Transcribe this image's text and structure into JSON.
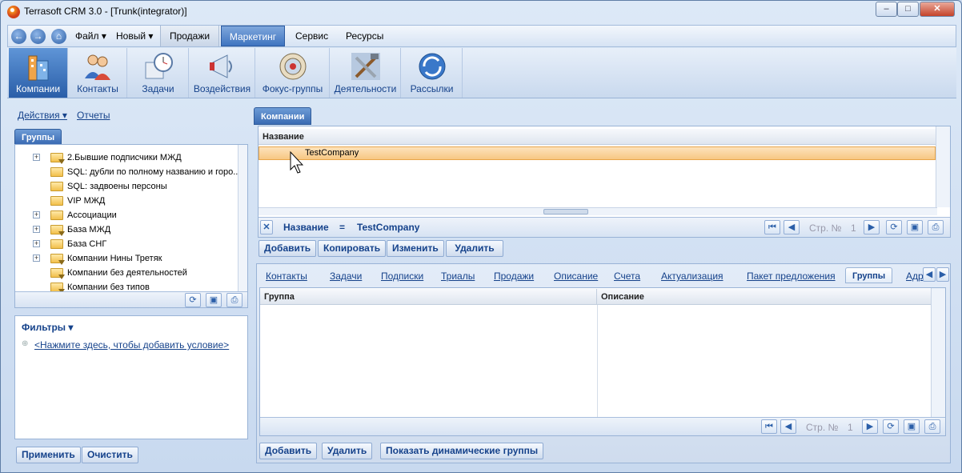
{
  "window": {
    "title": "Terrasoft CRM 3.0 - [Trunk(integrator)]"
  },
  "menubar": {
    "items": [
      "Файл",
      "Новый",
      "Продажи",
      "Маркетинг",
      "Сервис",
      "Ресурсы"
    ]
  },
  "ribbon": {
    "items": [
      "Компании",
      "Контакты",
      "Задачи",
      "Воздействия",
      "Фокус-группы",
      "Деятельности",
      "Рассылки"
    ]
  },
  "left": {
    "actions": "Действия",
    "reports": "Отчеты",
    "groups_tab": "Группы",
    "tree": [
      {
        "label": "2.Бывшие подписчики МЖД",
        "expand": true,
        "filter": true
      },
      {
        "label": "SQL: дубли по полному названию и горо...",
        "expand": false,
        "filter": false
      },
      {
        "label": "SQL: задвоены персоны",
        "expand": false,
        "filter": false
      },
      {
        "label": "VIP МЖД",
        "expand": false,
        "filter": false
      },
      {
        "label": "Ассоциации",
        "expand": true,
        "filter": false
      },
      {
        "label": "База МЖД",
        "expand": true,
        "filter": true
      },
      {
        "label": "База СНГ",
        "expand": true,
        "filter": false
      },
      {
        "label": "Компании Нины Третяк",
        "expand": true,
        "filter": true
      },
      {
        "label": "Компании без деятельностей",
        "expand": false,
        "filter": true
      },
      {
        "label": "Компании без типов",
        "expand": false,
        "filter": true
      }
    ],
    "filters_title": "Фильтры",
    "filters_add": "<Нажмите здесь, чтобы добавить условие>",
    "apply": "Применить",
    "clear": "Очистить"
  },
  "companies": {
    "tab": "Компании",
    "col_name": "Название",
    "row": "TestCompany",
    "filter_field": "Название",
    "filter_op": "=",
    "filter_value": "TestCompany",
    "page_label": "Стр. №",
    "page": "1",
    "buttons": [
      "Добавить",
      "Копировать",
      "Изменить",
      "Удалить"
    ]
  },
  "details": {
    "tabs": [
      "Контакты",
      "Задачи",
      "Подписки",
      "Триалы",
      "Продажи",
      "Описание",
      "Счета",
      "Актуализация",
      "Пакет предложения",
      "Группы",
      "Адр"
    ],
    "active_tab": "Группы",
    "col_group": "Группа",
    "col_desc": "Описание",
    "page_label": "Стр. №",
    "page": "1",
    "buttons": [
      "Добавить",
      "Удалить",
      "Показать динамические группы"
    ]
  }
}
